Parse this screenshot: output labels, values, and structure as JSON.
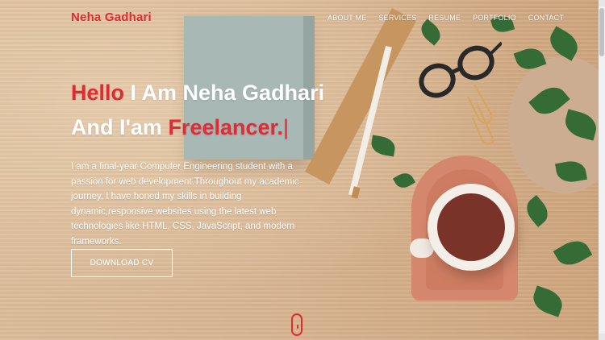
{
  "brand": {
    "name": "Neha Gadhari"
  },
  "nav": {
    "items": [
      "ABOUT ME",
      "SERVICES",
      "RESUME",
      "PORTFOLIO",
      "CONTACT"
    ]
  },
  "hero": {
    "line1_highlight": "Hello",
    "line1_rest": " I Am Neha Gadhari",
    "line2_prefix": "And I'am ",
    "line2_highlight": "Freelancer.",
    "cursor": "|",
    "description": "I am a final-year Computer Engineering student with a passion for web development.Throughout my academic journey, I have honed my skills in building dynamic,responsive websites using the latest web technologies like HTML, CSS, JavaScript, and modern frameworks.",
    "download_label": "DOWNLOAD CV"
  },
  "colors": {
    "accent": "#e02b35",
    "text": "#ffffff"
  },
  "icons": {
    "scroll_indicator": "mouse-scroll-icon"
  }
}
